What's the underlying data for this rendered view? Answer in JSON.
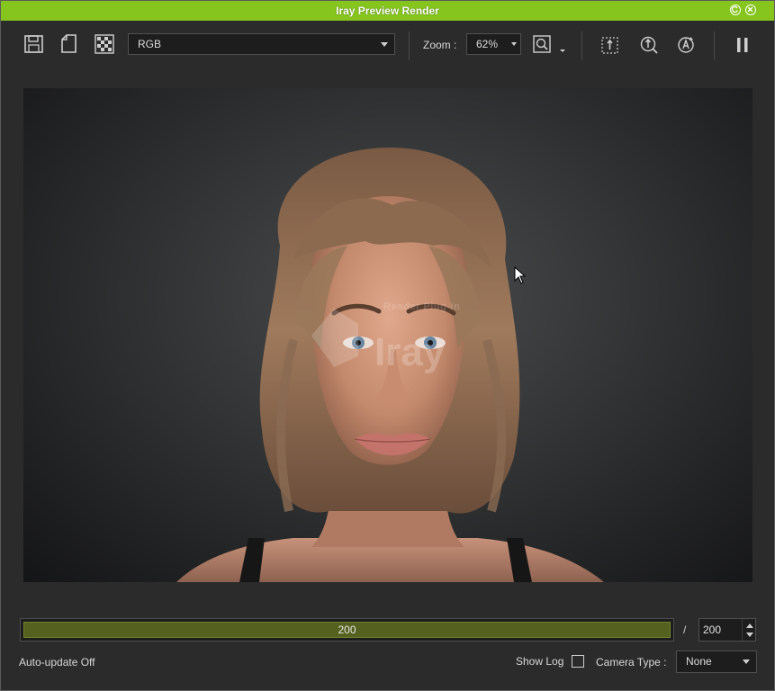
{
  "window": {
    "title": "Iray Preview Render"
  },
  "toolbar": {
    "channel_select": {
      "value": "RGB"
    },
    "zoom": {
      "label": "Zoom :",
      "value": "62%"
    },
    "icons": {
      "save": "save-icon",
      "copy": "copy-icon",
      "alpha": "checkerboard-icon",
      "fit": "zoom-fit-icon",
      "region": "render-region-icon",
      "pick": "pick-focus-icon",
      "auto": "auto-render-icon",
      "pause": "pause-icon"
    }
  },
  "viewport": {
    "watermark": "Render Plug-in"
  },
  "progress": {
    "current": "200",
    "fraction": 1.0,
    "separator": "/",
    "max_iterations": "200"
  },
  "footer": {
    "auto_update": "Auto-update Off",
    "show_log_label": "Show Log",
    "show_log_checked": false,
    "camera_type_label": "Camera Type :",
    "camera_type_value": "None"
  },
  "colors": {
    "titlebar": "#86c41e",
    "progress_fill": "#55621f",
    "panel": "#2b2b2b"
  }
}
